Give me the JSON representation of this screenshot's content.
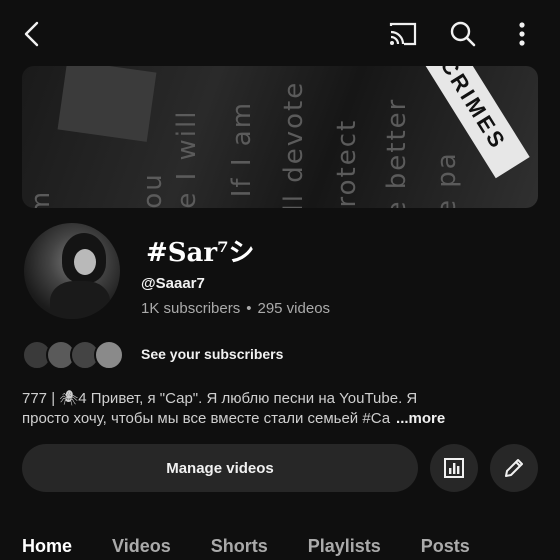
{
  "topbar": {
    "icons": [
      "back-arrow-icon",
      "cast-icon",
      "search-icon",
      "more-vert-icon"
    ]
  },
  "banner": {
    "texts": [
      "I'm",
      "you",
      "me I will",
      "as If I am",
      "will devote",
      "protect",
      "be better",
      "e pa",
      "CRIMES"
    ]
  },
  "channel": {
    "name": "#Sar⁷シ",
    "handle": "@Saaar7",
    "subscribers": "1K subscribers",
    "dot": "•",
    "videos": "295 videos"
  },
  "subscribers_row": {
    "label": "See your subscribers"
  },
  "description": {
    "line1": "777 | 🕷4 Привет, я \"Сар\".  Я люблю песни на YouTube. Я",
    "line2": "просто хочу, чтобы мы все вместе стали семьей #Са",
    "more": "...more"
  },
  "actions": {
    "manage_label": "Manage videos"
  },
  "tabs": [
    {
      "label": "Home",
      "active": true
    },
    {
      "label": "Videos",
      "active": false
    },
    {
      "label": "Shorts",
      "active": false
    },
    {
      "label": "Playlists",
      "active": false
    },
    {
      "label": "Posts",
      "active": false
    }
  ],
  "colors": {
    "background": "#0f0f0f",
    "button_bg": "#272727",
    "text_primary": "#f1f1f1",
    "text_secondary": "#aaaaaa"
  }
}
